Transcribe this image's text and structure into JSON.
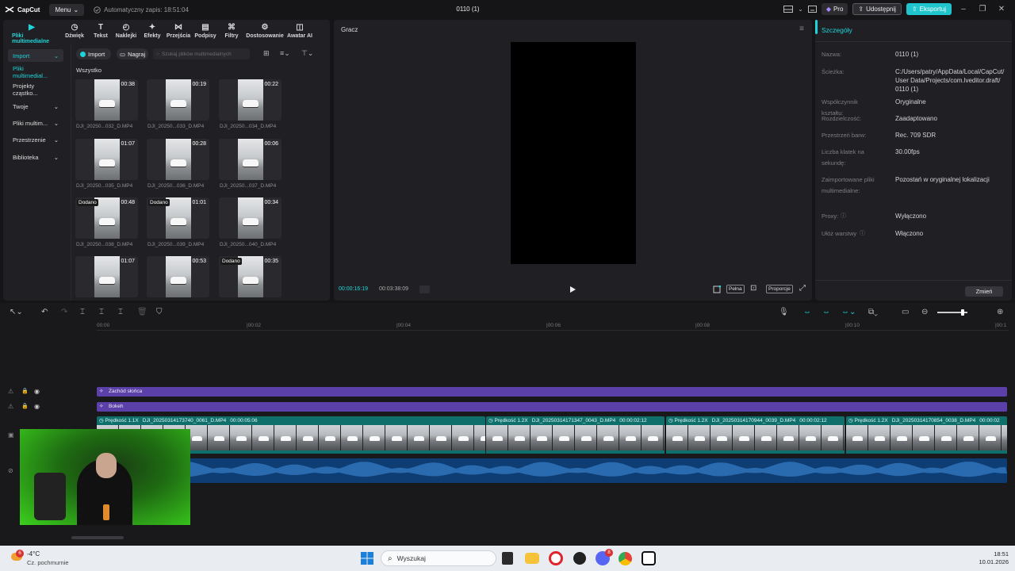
{
  "topbar": {
    "logo": "CapCut",
    "menu": "Menu",
    "autosave": "Automatyczny zapis: 18:51:04",
    "title": "0110 (1)",
    "pro": "Pro",
    "share": "Udostępnij",
    "export": "Eksportuj"
  },
  "media_tabs": [
    "Pliki multimedialne",
    "Dźwięk",
    "Tekst",
    "Naklejki",
    "Efekty",
    "Przejścia",
    "Podpisy",
    "Filtry",
    "Dostosowanie",
    "Awatar AI"
  ],
  "sidebar": [
    "Import",
    "Pliki multimedial...",
    "Projekty cząstko...",
    "Twoje",
    "Pliki multim...",
    "Przestrzenie",
    "Biblioteka"
  ],
  "media_toolbar": {
    "import": "Import",
    "record": "Nagraj",
    "search_placeholder": "Szukaj plików multimedialnych"
  },
  "media_section": "Wszystko",
  "media_items": [
    {
      "name": "DJI_20250...032_D.MP4",
      "duration": "00:38",
      "badge": ""
    },
    {
      "name": "DJI_20250...033_D.MP4",
      "duration": "00:19",
      "badge": ""
    },
    {
      "name": "DJI_20250...034_D.MP4",
      "duration": "00:22",
      "badge": ""
    },
    {
      "name": "DJI_20250...035_D.MP4",
      "duration": "01:07",
      "badge": ""
    },
    {
      "name": "DJI_20250...036_D.MP4",
      "duration": "00:28",
      "badge": ""
    },
    {
      "name": "DJI_20250...037_D.MP4",
      "duration": "00:06",
      "badge": ""
    },
    {
      "name": "DJI_20250...038_D.MP4",
      "duration": "00:48",
      "badge": "Dodano"
    },
    {
      "name": "DJI_20250...039_D.MP4",
      "duration": "01:01",
      "badge": "Dodano"
    },
    {
      "name": "DJI_20250...040_D.MP4",
      "duration": "00:34",
      "badge": ""
    },
    {
      "name": "",
      "duration": "01:07",
      "badge": ""
    },
    {
      "name": "",
      "duration": "00:53",
      "badge": ""
    },
    {
      "name": "",
      "duration": "00:35",
      "badge": "Dodano"
    }
  ],
  "player": {
    "title": "Gracz",
    "current_time": "00:00:16:19",
    "total_time": "00:03:38:09",
    "full": "Pełna",
    "ratio": "Proporcje"
  },
  "details": {
    "title": "Szczegóły",
    "rows": [
      {
        "label": "Nazwa:",
        "value": "0110 (1)"
      },
      {
        "label": "Ścieżka:",
        "value": "C:/Users/patry/AppData/Local/CapCut/ User Data/Projects/com.lveditor.draft/ 0110 (1)"
      },
      {
        "label": "Współczynnik kształtu:",
        "value": "Oryginalne"
      },
      {
        "label": "Rozdzielczość:",
        "value": "Zaadaptowano"
      },
      {
        "label": "Przestrzeń barw:",
        "value": "Rec. 709 SDR"
      },
      {
        "label": "Liczba klatek na sekundę:",
        "value": "30.00fps"
      },
      {
        "label": "Zaimportowane pliki multimedialne:",
        "value": "Pozostań w oryginalnej lokalizacji"
      },
      {
        "label": "Proxy:",
        "value": "Wyłączono"
      },
      {
        "label": "Ułóż warstwy",
        "value": "Włączono"
      }
    ],
    "change": "Zmień"
  },
  "timeline": {
    "ruler": [
      "00:00",
      "|00:02",
      "|00:04",
      "|00:06",
      "|00:08",
      "|00:10",
      "|00:1"
    ],
    "effect_tracks": [
      "Zachód słońca",
      "Bokeh"
    ],
    "clips": [
      {
        "speed": "Prędkość 1.1X",
        "name": "DJI_20250314173740_0061_D.MP4",
        "duration": "00:00:05:06"
      },
      {
        "speed": "Prędkość 1.2X",
        "name": "DJI_20250314171347_0043_D.MP4",
        "duration": "00:00:02:12"
      },
      {
        "speed": "Prędkość 1.2X",
        "name": "DJI_20250314170944_0039_D.MP4",
        "duration": "00:00:02:12"
      },
      {
        "speed": "Prędkość 1.2X",
        "name": "DJI_20250314170854_0038_D.MP4",
        "duration": "00:00:02"
      }
    ]
  },
  "taskbar": {
    "temperature": "-4°C",
    "weather": "Cz. pochmurnie",
    "weather_badge": "6",
    "search": "Wyszukaj",
    "time": "18:51",
    "date": "10.01.2026",
    "discord_badge": "8"
  },
  "colors": {
    "accent": "#1fc4cc",
    "effect_track": "#5a40a8",
    "clip": "#0e6f6b"
  }
}
